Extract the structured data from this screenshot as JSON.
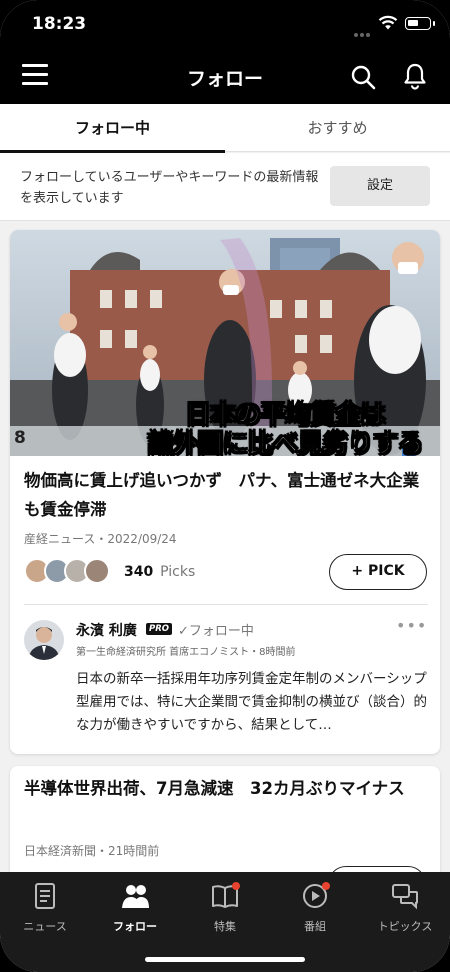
{
  "status_bar": {
    "time": "18:23"
  },
  "header": {
    "title": "フォロー",
    "icons": [
      "menu-icon",
      "search-icon",
      "bell-icon"
    ]
  },
  "tabs": [
    {
      "label": "フォロー中",
      "active": true
    },
    {
      "label": "おすすめ",
      "active": false
    }
  ],
  "info": {
    "text": "フォローしているユーザーやキーワードの最新情報を表示しています",
    "settings_label": "設定"
  },
  "articles": [
    {
      "image_caption": "日本の平均賃金は\n諸外国に比べ見劣りする",
      "image_chart_label": "8",
      "headline": "物価高に賃上げ追いつかず　パナ、富士通ゼネ大企業も賃金停滞",
      "source": "産経ニュース・2022/09/24",
      "picks_count": "340",
      "picks_label": "Picks",
      "pick_button": "+ PICK",
      "comment": {
        "author": "永濱 利廣",
        "badge": "PRO",
        "follow_state": "✓フォロー中",
        "affiliation": "第一生命経済研究所 首席エコノミスト・8時間前",
        "body": "日本の新卒一括採用年功序列賃金定年制のメンバーシップ型雇用では、特に大企業間で賃金抑制の横並び（談合）的な力が働きやすいですから、結果として…",
        "more": "•••"
      }
    },
    {
      "headline": "半導体世界出荷、7月急減速　32カ月ぶりマイナス",
      "source": "日本経済新聞・21時間前"
    }
  ],
  "bottom_nav": [
    {
      "label": "ニュース",
      "icon": "news-icon",
      "active": false,
      "badge": false
    },
    {
      "label": "フォロー",
      "icon": "people-icon",
      "active": true,
      "badge": false
    },
    {
      "label": "特集",
      "icon": "book-icon",
      "active": false,
      "badge": true
    },
    {
      "label": "番組",
      "icon": "play-icon",
      "active": false,
      "badge": true
    },
    {
      "label": "トピックス",
      "icon": "chat-icon",
      "active": false,
      "badge": false
    }
  ],
  "colors": {
    "header_bg": "#000000",
    "nav_bg": "#1b1b1b",
    "badge": "#e8432e"
  }
}
